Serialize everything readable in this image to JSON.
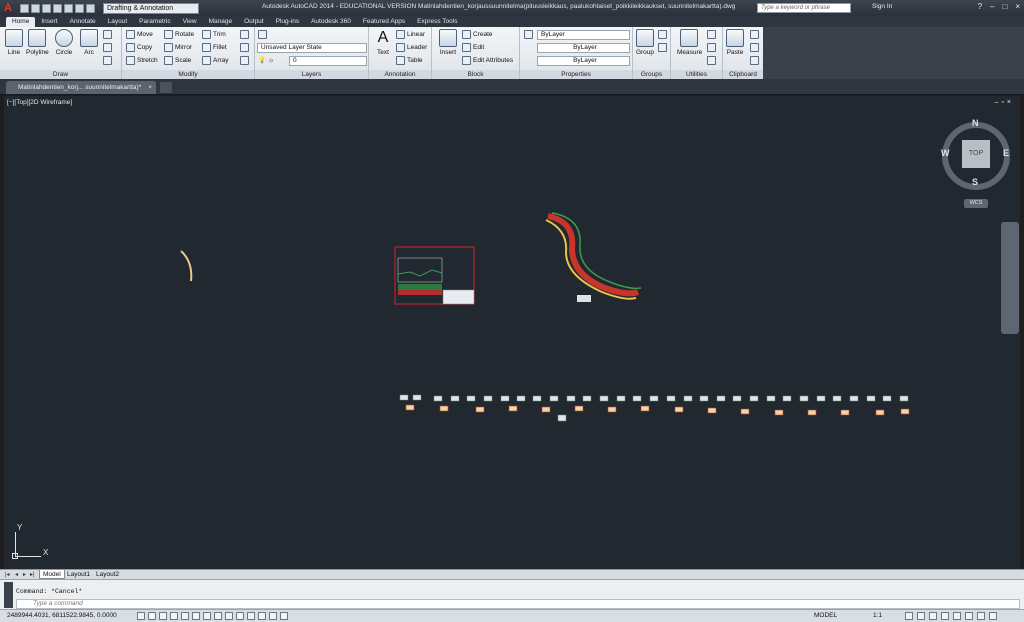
{
  "title_bar": {
    "workspace": "Drafting & Annotation",
    "title": "Autodesk AutoCAD 2014 - EDUCATIONAL VERSION    Matinlahdentien_korjaussuunnitelma(pituusleikkaus, paalukohtaiset_poikkileikkaukset, suunnitelmakartta).dwg",
    "search_placeholder": "Type a keyword or phrase",
    "sign_in": "Sign In",
    "help": "?"
  },
  "ribbon_tabs": [
    "Home",
    "Insert",
    "Annotate",
    "Layout",
    "Parametric",
    "View",
    "Manage",
    "Output",
    "Plug-ins",
    "Autodesk 360",
    "Featured Apps",
    "Express Tools"
  ],
  "ribbon": {
    "draw": {
      "title": "Draw",
      "line": "Line",
      "polyline": "Polyline",
      "circle": "Circle",
      "arc": "Arc"
    },
    "modify": {
      "title": "Modify",
      "move": "Move",
      "rotate": "Rotate",
      "trim": "Trim",
      "copy": "Copy",
      "mirror": "Mirror",
      "fillet": "Fillet",
      "stretch": "Stretch",
      "scale": "Scale",
      "array": "Array"
    },
    "layers": {
      "title": "Layers",
      "layer_state": "Unsaved Layer State",
      "current_layer": "0"
    },
    "annotation": {
      "title": "Annotation",
      "text": "Text",
      "linear": "Linear",
      "leader": "Leader",
      "table": "Table"
    },
    "block": {
      "title": "Block",
      "insert": "Insert",
      "create": "Create",
      "edit": "Edit",
      "edit_attributes": "Edit Attributes"
    },
    "properties": {
      "title": "Properties",
      "color": "ByLayer",
      "linetype": "ByLayer",
      "lineweight": "ByLayer"
    },
    "groups": {
      "title": "Groups",
      "group": "Group"
    },
    "utilities": {
      "title": "Utilities",
      "measure": "Measure"
    },
    "clipboard": {
      "title": "Clipboard",
      "paste": "Paste"
    }
  },
  "file_tab": {
    "label": "Matinlahdentien_korj... suunnitelmakartta)*",
    "close": "×"
  },
  "viewport": {
    "label": "[−][Top][2D Wireframe]",
    "compass": {
      "n": "N",
      "s": "S",
      "e": "E",
      "w": "W",
      "top": "TOP"
    },
    "wcs": "WCS",
    "ucs_x": "X",
    "ucs_y": "Y"
  },
  "layout_tabs": [
    "Model",
    "Layout1",
    "Layout2"
  ],
  "command": {
    "history": "Command: *Cancel*",
    "placeholder": "Type a command"
  },
  "status": {
    "coordinates": "2489944.4031, 6811522.9845, 0.0000",
    "mode": "MODEL",
    "scale": "1:1"
  }
}
